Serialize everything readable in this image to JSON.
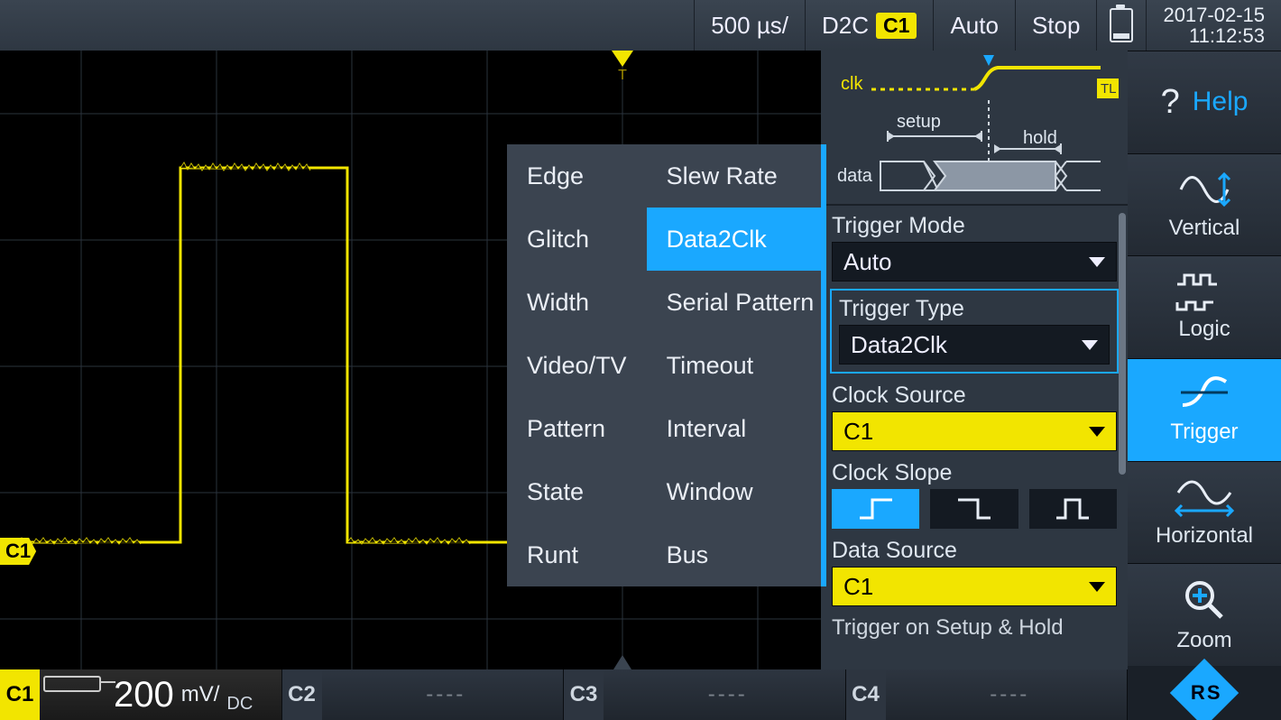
{
  "topbar": {
    "timebase": "500 µs/",
    "trigger_src_label": "D2C",
    "trigger_src_channel": "C1",
    "mode": "Auto",
    "runstate": "Stop",
    "date": "2017-02-15",
    "time": "11:12:53"
  },
  "sidekeys": {
    "help": "Help",
    "vertical": "Vertical",
    "logic": "Logic",
    "trigger": "Trigger",
    "horizontal": "Horizontal",
    "zoom": "Zoom"
  },
  "trigger_types": {
    "col1": [
      "Edge",
      "Glitch",
      "Width",
      "Video/TV",
      "Pattern",
      "State",
      "Runt"
    ],
    "col2": [
      "Slew Rate",
      "Data2Clk",
      "Serial Pattern",
      "Timeout",
      "Interval",
      "Window",
      "Bus"
    ],
    "selected": "Data2Clk"
  },
  "diagram": {
    "clk": "clk",
    "data": "data",
    "setup": "setup",
    "hold": "hold",
    "tl": "TL"
  },
  "props": {
    "trigger_mode_label": "Trigger Mode",
    "trigger_mode_value": "Auto",
    "trigger_type_label": "Trigger Type",
    "trigger_type_value": "Data2Clk",
    "clock_source_label": "Clock Source",
    "clock_source_value": "C1",
    "clock_slope_label": "Clock Slope",
    "data_source_label": "Data Source",
    "data_source_value": "C1",
    "setup_hold_label": "Trigger on Setup & Hold"
  },
  "channels": {
    "c1": {
      "tag": "C1",
      "value": "200",
      "unit": "mV/",
      "coupling": "DC"
    },
    "c2": {
      "tag": "C2"
    },
    "c3": {
      "tag": "C3"
    },
    "c4": {
      "tag": "C4"
    }
  },
  "waveform_badge": "C1"
}
